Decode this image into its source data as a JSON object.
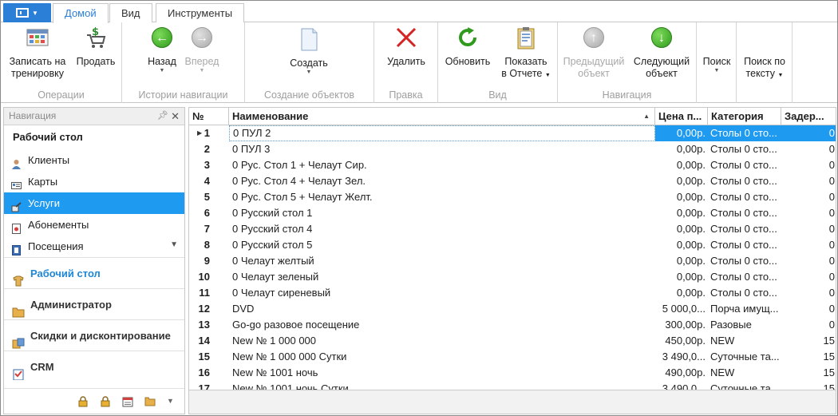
{
  "tabs": [
    {
      "label": "Домой",
      "active": true
    },
    {
      "label": "Вид",
      "active": false
    },
    {
      "label": "Инструменты",
      "active": false
    }
  ],
  "ribbon": {
    "groups": {
      "operations": "Операции",
      "history": "Истории навигации",
      "create": "Создание объектов",
      "edit": "Правка",
      "view": "Вид",
      "navigation": "Навигация"
    },
    "buttons": {
      "record_l1": "Записать на",
      "record_l2": "тренировку",
      "sell": "Продать",
      "back": "Назад",
      "forward": "Вперед",
      "create": "Создать",
      "delete": "Удалить",
      "refresh": "Обновить",
      "report_l1": "Показать",
      "report_l2": "в Отчете",
      "prev_l1": "Предыдущий",
      "prev_l2": "объект",
      "next_l1": "Следующий",
      "next_l2": "объект",
      "search": "Поиск",
      "search_text_l1": "Поиск по",
      "search_text_l2": "тексту"
    }
  },
  "nav": {
    "header": "Навигация",
    "title": "Рабочий стол",
    "items": [
      {
        "label": "Клиенты"
      },
      {
        "label": "Карты"
      },
      {
        "label": "Услуги",
        "selected": true
      },
      {
        "label": "Абонементы"
      },
      {
        "label": "Посещения"
      }
    ],
    "sections": [
      {
        "label": "Рабочий стол",
        "active": true
      },
      {
        "label": "Администратор"
      },
      {
        "label": "Скидки и дисконтирование"
      },
      {
        "label": "CRM"
      }
    ]
  },
  "grid": {
    "columns": {
      "num": "№",
      "name": "Наименование",
      "price": "Цена п...",
      "category": "Категория",
      "delay": "Задер..."
    },
    "rows": [
      {
        "num": "1",
        "name": "0 ПУЛ 2",
        "price": "0,00р.",
        "category": "Столы 0 сто...",
        "delay": "0"
      },
      {
        "num": "2",
        "name": "0 ПУЛ 3",
        "price": "0,00р.",
        "category": "Столы 0 сто...",
        "delay": "0"
      },
      {
        "num": "3",
        "name": "0 Рус. Стол 1 + Челаут Сир.",
        "price": "0,00р.",
        "category": "Столы 0 сто...",
        "delay": "0"
      },
      {
        "num": "4",
        "name": "0 Рус. Стол 4 + Челаут Зел.",
        "price": "0,00р.",
        "category": "Столы 0 сто...",
        "delay": "0"
      },
      {
        "num": "5",
        "name": "0 Рус. Стол 5 + Челаут Желт.",
        "price": "0,00р.",
        "category": "Столы 0 сто...",
        "delay": "0"
      },
      {
        "num": "6",
        "name": "0 Русский стол 1",
        "price": "0,00р.",
        "category": "Столы 0 сто...",
        "delay": "0"
      },
      {
        "num": "7",
        "name": "0 Русский стол 4",
        "price": "0,00р.",
        "category": "Столы 0 сто...",
        "delay": "0"
      },
      {
        "num": "8",
        "name": "0 Русский стол 5",
        "price": "0,00р.",
        "category": "Столы 0 сто...",
        "delay": "0"
      },
      {
        "num": "9",
        "name": "0 Челаут желтый",
        "price": "0,00р.",
        "category": "Столы 0 сто...",
        "delay": "0"
      },
      {
        "num": "10",
        "name": "0 Челаут зеленый",
        "price": "0,00р.",
        "category": "Столы 0 сто...",
        "delay": "0"
      },
      {
        "num": "11",
        "name": "0 Челаут сиреневый",
        "price": "0,00р.",
        "category": "Столы 0 сто...",
        "delay": "0"
      },
      {
        "num": "12",
        "name": "DVD",
        "price": "5 000,0...",
        "category": "Порча имущ...",
        "delay": "0"
      },
      {
        "num": "13",
        "name": "Go-go разовое посещение",
        "price": "300,00р.",
        "category": "Разовые",
        "delay": "0"
      },
      {
        "num": "14",
        "name": "New № 1 000 000",
        "price": "450,00р.",
        "category": "NEW",
        "delay": "15"
      },
      {
        "num": "15",
        "name": "New № 1 000 000 Сутки",
        "price": "3 490,0...",
        "category": "Суточные та...",
        "delay": "15"
      },
      {
        "num": "16",
        "name": "New № 1001 ночь",
        "price": "490,00р.",
        "category": "NEW",
        "delay": "15"
      },
      {
        "num": "17",
        "name": "New № 1001 ночь Сутки",
        "price": "3 490,0...",
        "category": "Суточные та...",
        "delay": "15"
      }
    ]
  }
}
